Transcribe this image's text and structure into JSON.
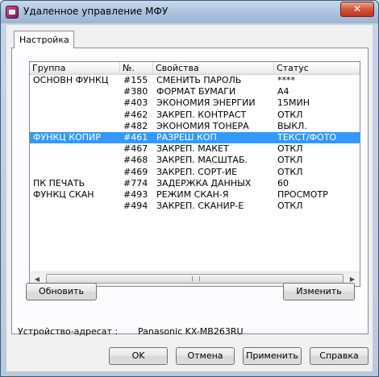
{
  "window": {
    "title": "Удаленное управление МФУ",
    "close_label": "✕"
  },
  "tabs": [
    {
      "label": "Настройка",
      "active": true
    }
  ],
  "table": {
    "columns": [
      "Группа",
      "№.",
      "Свойства",
      "Статус"
    ],
    "rows": [
      {
        "group": "ОСНОВН ФУНКЦ",
        "num": "#155",
        "prop": "СМЕНИТЬ ПАРОЛЬ",
        "status": "****",
        "selected": false
      },
      {
        "group": "",
        "num": "#380",
        "prop": "ФОРМАТ БУМАГИ",
        "status": "A4",
        "selected": false
      },
      {
        "group": "",
        "num": "#403",
        "prop": "ЭКОНОМИЯ ЭНЕРГИИ",
        "status": "15МИН",
        "selected": false
      },
      {
        "group": "",
        "num": "#462",
        "prop": "ЗАКРЕП. КОНТРАСТ",
        "status": "ОТКЛ",
        "selected": false
      },
      {
        "group": "",
        "num": "#482",
        "prop": "ЭКОНОМИЯ ТОНЕРА",
        "status": "ВЫКЛ.",
        "selected": false
      },
      {
        "group": "ФУНКЦ КОПИР",
        "num": "#461",
        "prop": "РАЗРЕШ КОП",
        "status": "ТЕКСТ/ФОТО",
        "selected": true
      },
      {
        "group": "",
        "num": "#467",
        "prop": "ЗАКРЕП. МАКЕТ",
        "status": "ОТКЛ",
        "selected": false
      },
      {
        "group": "",
        "num": "#468",
        "prop": "ЗАКРЕП. МАСШТАБ.",
        "status": "ОТКЛ",
        "selected": false
      },
      {
        "group": "",
        "num": "#469",
        "prop": "ЗАКРЕП. СОРТ-ИЕ",
        "status": "ОТКЛ",
        "selected": false
      },
      {
        "group": "ПК ПЕЧАТЬ",
        "num": "#774",
        "prop": "ЗАДЕРЖКА ДАННЫХ",
        "status": "60",
        "selected": false
      },
      {
        "group": "ФУНКЦ СКАН",
        "num": "#493",
        "prop": "РЕЖИМ СКАН-Я",
        "status": "ПРОСМОТР",
        "selected": false
      },
      {
        "group": "",
        "num": "#494",
        "prop": "ЗАКРЕП. СКАНИР-Е",
        "status": "ОТКЛ",
        "selected": false
      }
    ]
  },
  "panel_buttons": {
    "refresh_label": "Обновить",
    "change_label": "Изменить"
  },
  "device": {
    "label": "Устройство-адресат :",
    "value": "Panasonic KX-MB263RU"
  },
  "footer_buttons": {
    "ok": "OK",
    "cancel": "Отмена",
    "apply": "Применить",
    "help": "Справка"
  },
  "colors": {
    "selection": "#3399ff",
    "close_button": "#c0341c"
  }
}
